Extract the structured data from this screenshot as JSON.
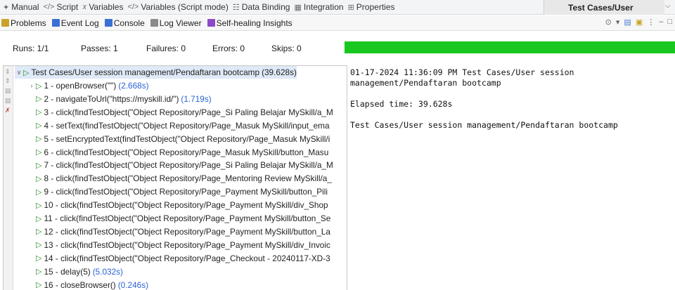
{
  "tabs": [
    {
      "icon": "manual-icon",
      "glyph": "✦",
      "label": "Manual"
    },
    {
      "icon": "script-icon",
      "glyph": "</>",
      "label": "Script"
    },
    {
      "icon": "variables-icon",
      "glyph": "𝑥",
      "label": "Variables"
    },
    {
      "icon": "script-variables-icon",
      "glyph": "</>",
      "label": "Variables (Script mode)"
    },
    {
      "icon": "database-icon",
      "glyph": "☷",
      "label": "Data Binding"
    },
    {
      "icon": "integration-icon",
      "glyph": "▦",
      "label": "Integration"
    },
    {
      "icon": "properties-icon",
      "glyph": "⊞",
      "label": "Properties"
    }
  ],
  "editor_tab": "Test Cases/User",
  "views": [
    {
      "icon": "problems-icon",
      "color": "#c9a227",
      "label": "Problems"
    },
    {
      "icon": "event-log-icon",
      "color": "#3b6fd4",
      "label": "Event Log"
    },
    {
      "icon": "console-icon",
      "color": "#3b6fd4",
      "label": "Console"
    },
    {
      "icon": "log-viewer-icon",
      "color": "#8a8a8a",
      "label": "Log Viewer"
    },
    {
      "icon": "self-healing-icon",
      "color": "#8b49c9",
      "label": "Self-healing Insights"
    }
  ],
  "stats": {
    "runs": "Runs: 1/1",
    "passes": "Passes: 1",
    "failures": "Failures: 0",
    "errors": "Errors: 0",
    "skips": "Skips: 0"
  },
  "progress_percent": 100,
  "colors": {
    "pass": "#18c71f",
    "duration": "#2a63d4"
  },
  "tree": {
    "root": {
      "label": "Test Cases/User session management/Pendaftaran bootcamp",
      "duration": "(39.628s)"
    },
    "steps": [
      {
        "label": "1 - openBrowser(\"\")",
        "duration": "(2.668s)",
        "expandable": true
      },
      {
        "label": "2 - navigateToUrl(\"https://myskill.id/\")",
        "duration": "(1.719s)"
      },
      {
        "label": "3 - click(findTestObject(\"Object Repository/Page_Si Paling Belajar  MySkill/a_M",
        "duration": ""
      },
      {
        "label": "4 - setText(findTestObject(\"Object Repository/Page_Masuk  MySkill/input_ema",
        "duration": ""
      },
      {
        "label": "5 - setEncryptedText(findTestObject(\"Object Repository/Page_Masuk  MySkill/i",
        "duration": ""
      },
      {
        "label": "6 - click(findTestObject(\"Object Repository/Page_Masuk  MySkill/button_Masu",
        "duration": ""
      },
      {
        "label": "7 - click(findTestObject(\"Object Repository/Page_Si Paling Belajar  MySkill/a_M",
        "duration": ""
      },
      {
        "label": "8 - click(findTestObject(\"Object Repository/Page_Mentoring Review  MySkill/a_",
        "duration": ""
      },
      {
        "label": "9 - click(findTestObject(\"Object Repository/Page_Payment  MySkill/button_Pili",
        "duration": ""
      },
      {
        "label": "10 - click(findTestObject(\"Object Repository/Page_Payment  MySkill/div_Shop",
        "duration": ""
      },
      {
        "label": "11 - click(findTestObject(\"Object Repository/Page_Payment  MySkill/button_Se",
        "duration": ""
      },
      {
        "label": "12 - click(findTestObject(\"Object Repository/Page_Payment  MySkill/button_La",
        "duration": ""
      },
      {
        "label": "13 - click(findTestObject(\"Object Repository/Page_Payment  MySkill/div_Invoic",
        "duration": ""
      },
      {
        "label": "14 - click(findTestObject(\"Object Repository/Page_Checkout - 20240117-XD-3",
        "duration": ""
      },
      {
        "label": "15 - delay(5)",
        "duration": "(5.032s)"
      },
      {
        "label": "16 - closeBrowser()",
        "duration": "(0.246s)"
      }
    ]
  },
  "output": {
    "line1": "01-17-2024 11:36:09 PM Test Cases/User session",
    "line2": "management/Pendaftaran bootcamp",
    "line3": "Elapsed time: 39.628s",
    "line4": "Test Cases/User session management/Pendaftaran bootcamp"
  }
}
